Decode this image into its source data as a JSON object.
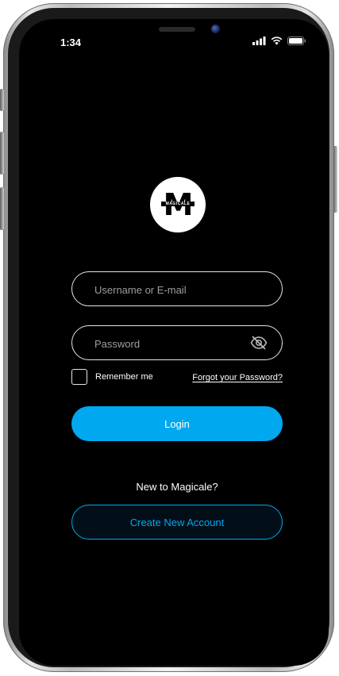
{
  "status_bar": {
    "time": "1:34",
    "icons": [
      "signal-icon",
      "wifi-icon",
      "battery-icon"
    ]
  },
  "logo": {
    "letter": "M",
    "wordmark": "MAGICALE"
  },
  "form": {
    "username_placeholder": "Username or E-mail",
    "password_placeholder": "Password",
    "password_toggle_icon": "eye-off-icon",
    "remember_label": "Remember me",
    "forgot_label": "Forgot your Password?",
    "login_label": "Login"
  },
  "signup": {
    "prompt": "New to Magicale?",
    "create_label": "Create New Account"
  },
  "colors": {
    "accent": "#00a8f0",
    "background": "#000000",
    "text": "#ffffff",
    "placeholder": "#9e9e9e"
  }
}
